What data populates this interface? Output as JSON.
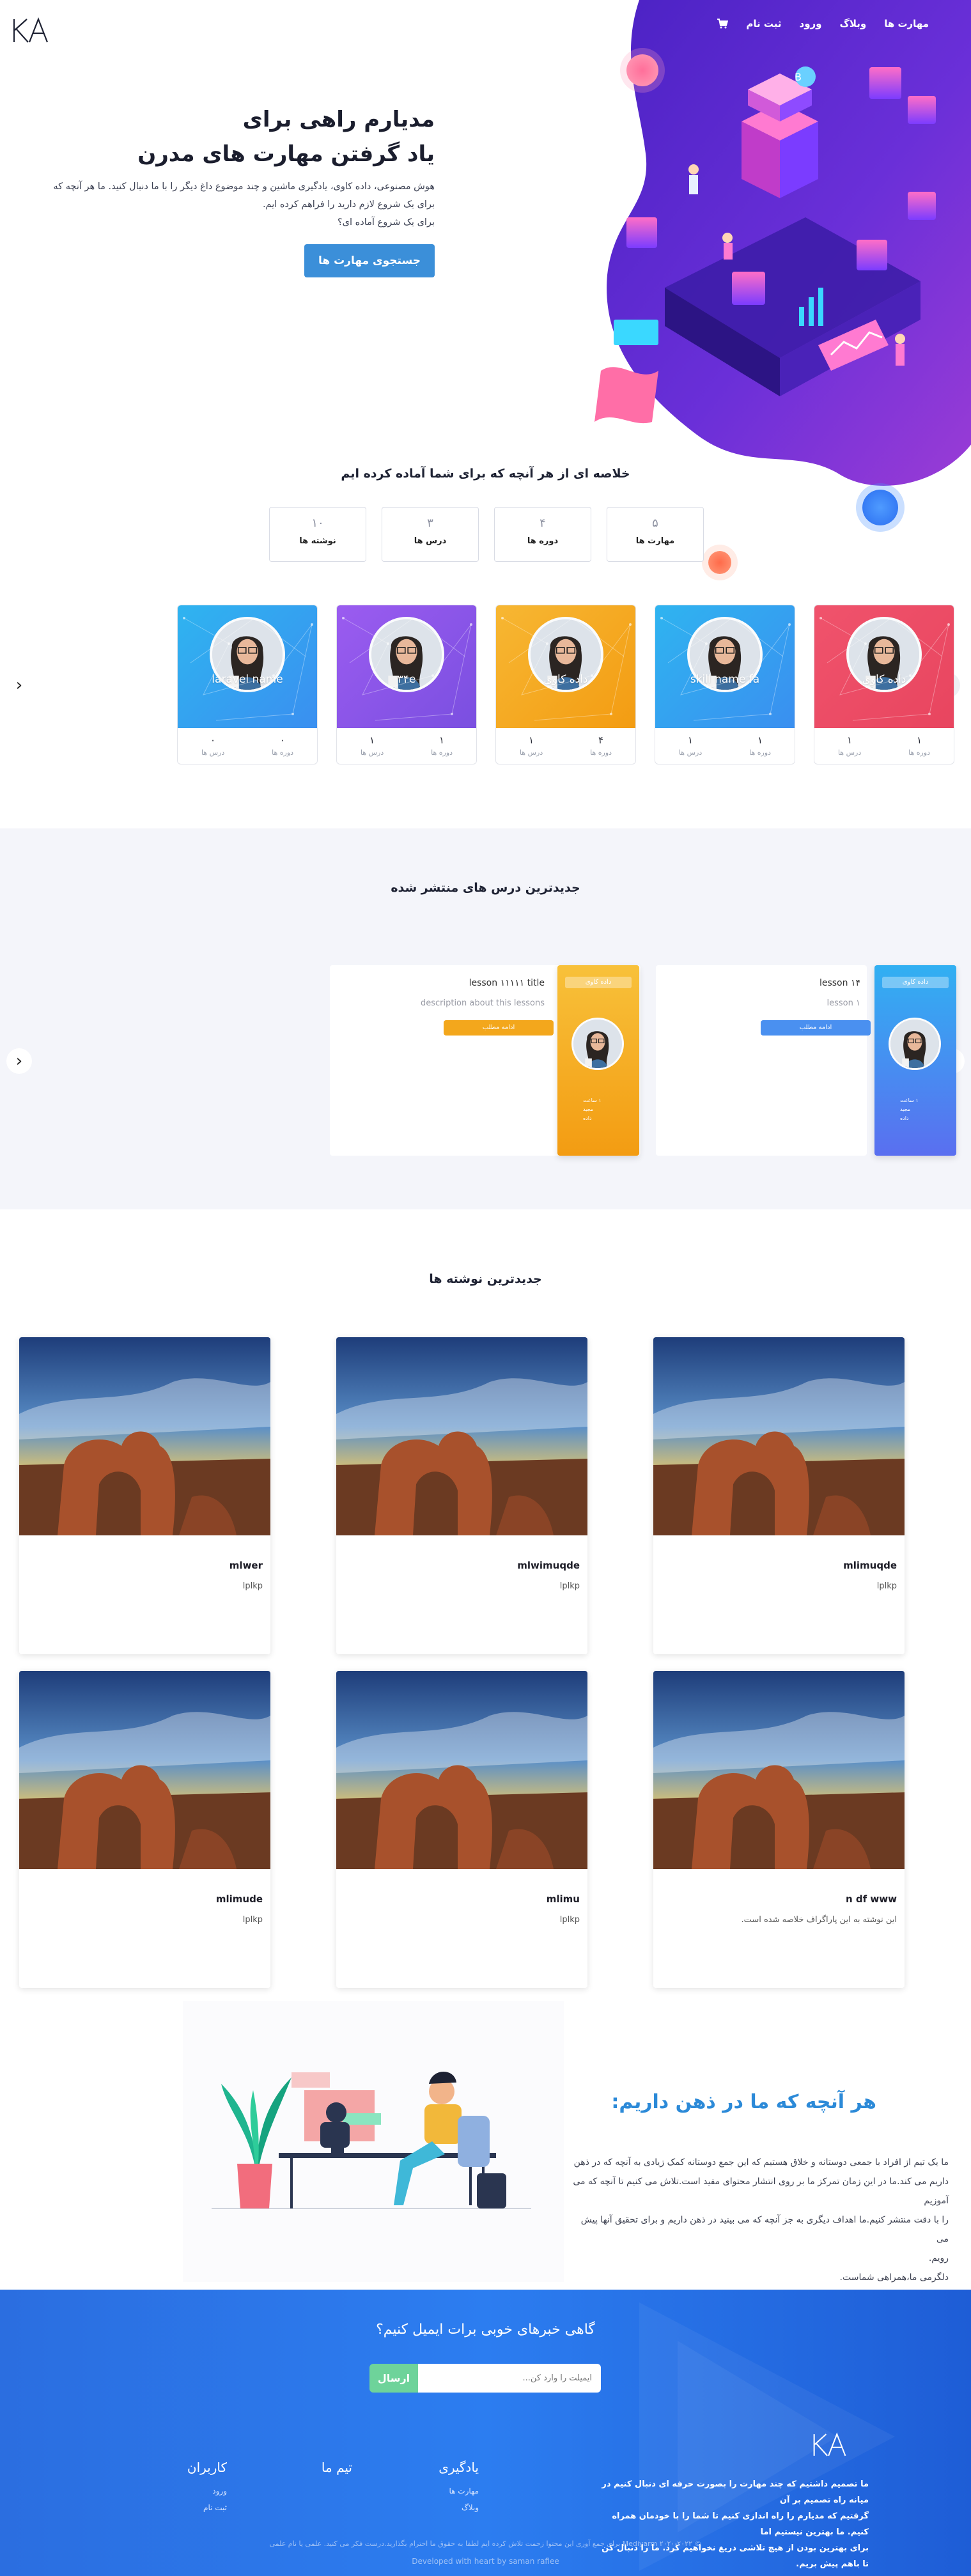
{
  "brand": {
    "logo": "KA"
  },
  "nav": {
    "items": [
      "مهارت ها",
      "وبلاگ",
      "ورود",
      "ثبت نام"
    ],
    "cart_icon": "cart-icon"
  },
  "hero": {
    "title_line1": "مدیارم راهی برای",
    "title_line2": "یاد گرفتن مهارت های مدرن",
    "desc_line1": "هوش مصنوعی، داده کاوی، یادگیری ماشین و چند موضوع داغ دیگر را با ما دنبال کنید. ما هر آنچه که",
    "desc_line2": "برای یک شروع لازم دارید را فراهم کرده ایم.",
    "desc_line3": "برای یک شروع آماده ای؟",
    "button": "جستجوی مهارت ها"
  },
  "summary": {
    "title": "خلاصه ای از هر آنچه که برای شما آماده کرده ایم",
    "stats": [
      {
        "value": "۱۰",
        "label": "نوشته ها"
      },
      {
        "value": "۳",
        "label": "درس ها"
      },
      {
        "value": "۴",
        "label": "دوره ها"
      },
      {
        "value": "۵",
        "label": "مهارت ها"
      }
    ]
  },
  "skills": [
    {
      "name": "laravel name",
      "stats": [
        {
          "v": "۰",
          "k": "درس ها"
        },
        {
          "v": "۰",
          "k": "دوره ها"
        }
      ],
      "color1": "#2fb4f0",
      "color2": "#3a8ff0"
    },
    {
      "name": "۳۴e",
      "stats": [
        {
          "v": "۱",
          "k": "درس ها"
        },
        {
          "v": "۱",
          "k": "دوره ها"
        }
      ],
      "color1": "#9b5cf0",
      "color2": "#7a4fe0"
    },
    {
      "name": "داده کاوی",
      "stats": [
        {
          "v": "۱",
          "k": "درس ها"
        },
        {
          "v": "۴",
          "k": "دوره ها"
        }
      ],
      "color1": "#f7b733",
      "color2": "#f39c12"
    },
    {
      "name": "skill name fa",
      "stats": [
        {
          "v": "۱",
          "k": "درس ها"
        },
        {
          "v": "۱",
          "k": "دوره ها"
        }
      ],
      "color1": "#2fb4f0",
      "color2": "#3a8ff0"
    },
    {
      "name": "داده کاوی",
      "stats": [
        {
          "v": "۱",
          "k": "درس ها"
        },
        {
          "v": "۱",
          "k": "دوره ها"
        }
      ],
      "color1": "#f0536c",
      "color2": "#e8455f"
    }
  ],
  "lessons": {
    "title": "جدیدترین درس های منتشر شده",
    "items": [
      {
        "tag": "داده کاوی",
        "title": "lesson ۱۱۱۱۱ title",
        "desc": "description about this lessons",
        "button": "ادامه مطلب",
        "meta": [
          "۱ ساعت",
          "مجید",
          "داده"
        ],
        "color1": "#f8c13a",
        "color2": "#f39c12",
        "btn_color": "#f3a71c"
      },
      {
        "tag": "داده کاوی",
        "title": "lesson ۱۴",
        "desc": "lesson ۱",
        "button": "ادامه مطلب",
        "meta": [
          "۱ ساعت",
          "مجید",
          "داده"
        ],
        "color1": "#31b0f2",
        "color2": "#5a6ff0",
        "btn_color": "#4a90f0"
      }
    ]
  },
  "posts": {
    "title": "جدیدترین نوشته ها",
    "items": [
      {
        "title": "mlimuqde",
        "desc": "lplkp"
      },
      {
        "title": "mlwimuqde",
        "desc": "lplkp"
      },
      {
        "title": "mlwer",
        "desc": "lplkp"
      },
      {
        "title": "n df www",
        "desc": "این نوشته به این پاراگراف خلاصه شده است."
      },
      {
        "title": "mlimu",
        "desc": "lplkp"
      },
      {
        "title": "mlimude",
        "desc": "lplkp"
      }
    ]
  },
  "about": {
    "title": "هر آنچه که ما در ذهن داریم:",
    "line1": "ما یک تیم از افراد با جمعی دوستانه و خلاق هستیم که این جمع دوستانه کمک زیادی به آنچه که در ذهن",
    "line2": "داریم می کند.ما در این زمان تمرکز ما بر روی انتشار محتوای مفید است.تلاش می کنیم تا آنچه که می آموزیم",
    "line3": "را با دقت منتشر کنیم.ما اهداف دیگری به جز آنچه که می بینید در ذهن داریم و برای تحقیق آنها پیش می",
    "line4": "رویم.",
    "line5": "دلگرمی ما،همراهی شماست."
  },
  "newsletter": {
    "title": "گاهی خبرهای خوبی برات ایمیل کنیم؟",
    "placeholder": "ایمیلت را وارد کن...",
    "button": "ارسال"
  },
  "footer": {
    "about_line1": "ما تصمیم داشتیم که چند مهارت را بصورت حرفه ای دنبال کنیم در میانه راه تصمیم بر آن",
    "about_line2": "گرفتیم که مدیارم را راه اندازی کنیم تا شما را با خودمان همراه کنیم. ما بهترین نیستیم اما",
    "about_line3": "برای بهترین بودن از هیچ تلاشی دریغ نخواهیم کرد. ما را دنبال کن تا باهم پیش بریم.",
    "col_learning": {
      "title": "یادگیری",
      "links": [
        "مهارت ها",
        "وبلاگ"
      ]
    },
    "col_team": {
      "title": "تیم ما",
      "links": []
    },
    "col_users": {
      "title": "کاربران",
      "links": [
        "ورود",
        "ثبت نام"
      ]
    },
    "copyright": "© ۲۰۲۰-۲۰۲۲ Mediyarm برای جمع آوری این محتوا زحمت تلاش کرده ایم لطفا به حقوق ما احترام بگذارید.درست فکر می کنید. علمی یا نام علمی",
    "developer": "Developed with heart by saman rafiee"
  },
  "colors": {
    "primary": "#3b8fd9",
    "hero_purple": "#5b2fd6",
    "footer_blue": "#2c7df0",
    "success": "#6ed39a"
  }
}
